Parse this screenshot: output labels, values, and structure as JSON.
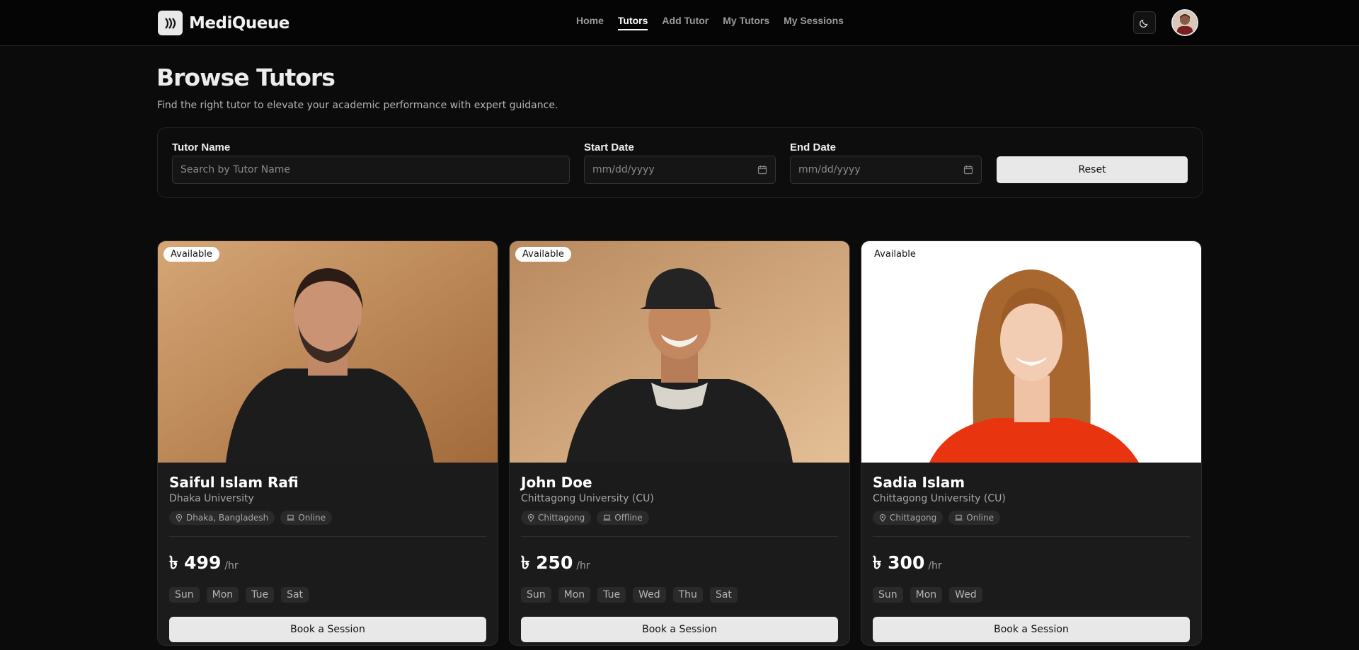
{
  "app": {
    "title": "MediQueue"
  },
  "nav": [
    {
      "label": "Home",
      "active": false
    },
    {
      "label": "Tutors",
      "active": true
    },
    {
      "label": "Add Tutor",
      "active": false
    },
    {
      "label": "My Tutors",
      "active": false
    },
    {
      "label": "My Sessions",
      "active": false
    }
  ],
  "page": {
    "title": "Browse Tutors",
    "subtitle": "Find the right tutor to elevate your academic performance with expert guidance."
  },
  "filter": {
    "name_label": "Tutor Name",
    "name_placeholder": "Search by Tutor Name",
    "start_label": "Start Date",
    "start_placeholder": "mm/dd/yyyy",
    "end_label": "End Date",
    "end_placeholder": "mm/dd/yyyy",
    "reset_label": "Reset"
  },
  "tutors": [
    {
      "badge": "Available",
      "name": "Saiful Islam Rafi",
      "university": "Dhaka University",
      "location": "Dhaka, Bangladesh",
      "mode": "Online",
      "price": "৳ 499",
      "per": "/hr",
      "days": [
        "Sun",
        "Mon",
        "Tue",
        "Sat"
      ],
      "book_label": "Book a Session"
    },
    {
      "badge": "Available",
      "name": "John Doe",
      "university": "Chittagong University (CU)",
      "location": "Chittagong",
      "mode": "Offline",
      "price": "৳ 250",
      "per": "/hr",
      "days": [
        "Sun",
        "Mon",
        "Tue",
        "Wed",
        "Thu",
        "Sat"
      ],
      "book_label": "Book a Session"
    },
    {
      "badge": "Available",
      "name": "Sadia Islam",
      "university": "Chittagong University (CU)",
      "location": "Chittagong",
      "mode": "Online",
      "price": "৳ 300",
      "per": "/hr",
      "days": [
        "Sun",
        "Mon",
        "Wed"
      ],
      "book_label": "Book a Session"
    }
  ],
  "colors": {
    "accent": "#e8e8e8",
    "background": "#0b0b0b",
    "card": "#1b1b1b"
  }
}
